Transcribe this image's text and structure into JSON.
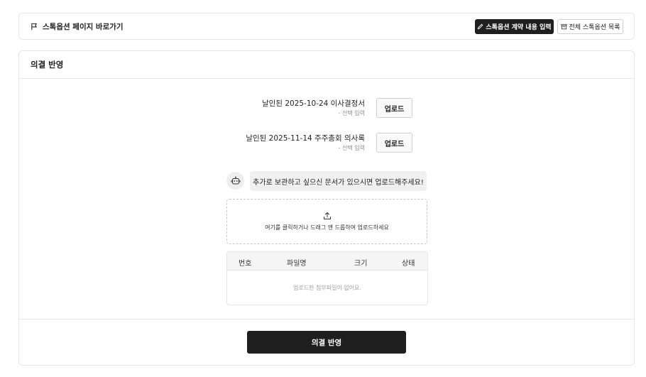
{
  "topbar": {
    "nav_link_label": "스톡옵션 페이지 바로가기",
    "contract_button_label": "스톡옵션 계약 내용 입력",
    "list_button_label": "전체 스톡옵션 목록"
  },
  "card": {
    "title": "의결 반영",
    "documents": [
      {
        "title": "날인된 2025-10-24 이사결정서",
        "subtitle": "- 선택 입력",
        "button_label": "업로드"
      },
      {
        "title": "날인된 2025-11-14 주주총회 의사록",
        "subtitle": "- 선택 입력",
        "button_label": "업로드"
      }
    ],
    "bot_message": "추가로 보관하고 싶으신 문서가 있으시면 업로드해주세요!",
    "dropzone_text": "여기를 클릭하거나 드래그 앤 드롭하여 업로드하세요",
    "table": {
      "columns": [
        "번호",
        "파일명",
        "크기",
        "상태"
      ],
      "empty_text": "업로드한 첨부파일이 없어요."
    },
    "submit_label": "의결 반영"
  },
  "icons": {
    "flag": "flag-icon",
    "pencil": "pencil-icon",
    "archive": "archive-icon",
    "bot": "bot-icon",
    "upload": "upload-icon"
  },
  "colors": {
    "primary_button": "#1f1f1f",
    "border": "#e6e6e6",
    "bubble_bg": "#f0f0f0"
  }
}
